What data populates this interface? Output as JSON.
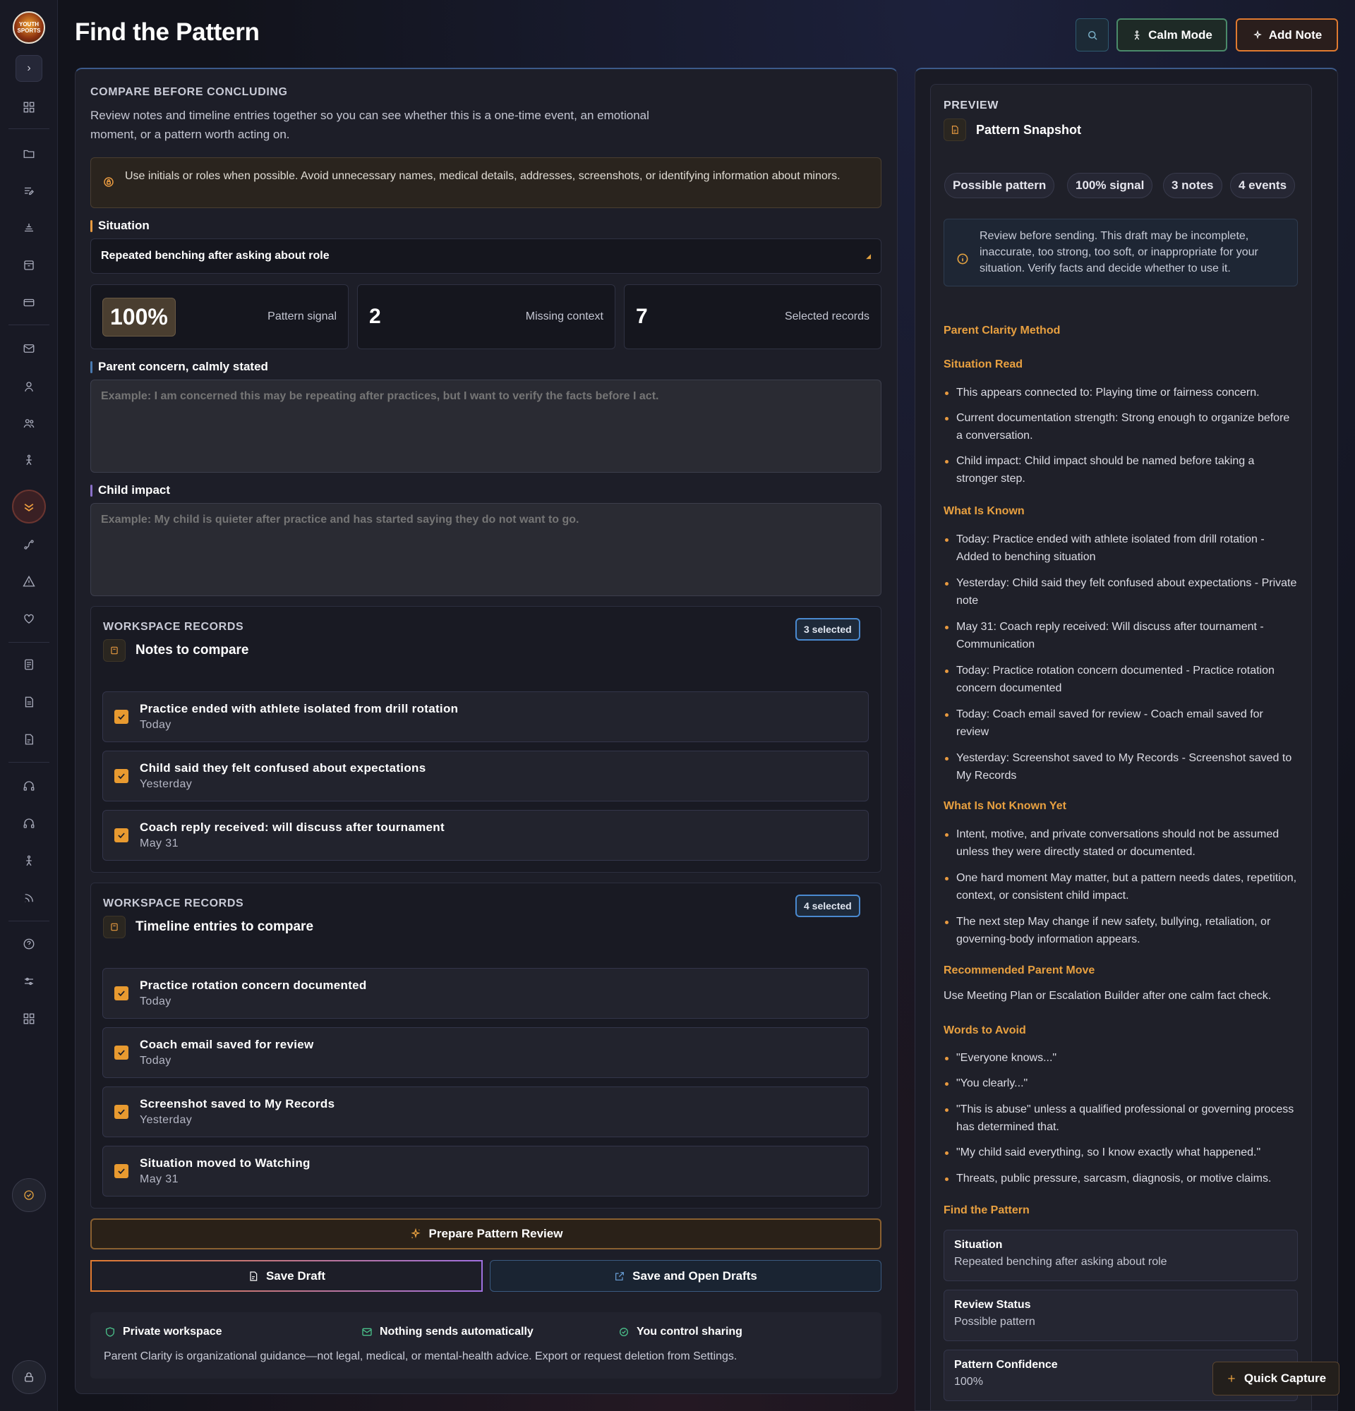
{
  "app": {
    "logo_text": "YOUTH SPORTS",
    "page_title": "Find the Pattern"
  },
  "header": {
    "calm_mode_label": "Calm Mode",
    "add_note_label": "Add Note"
  },
  "compare": {
    "eyebrow": "COMPARE BEFORE CONCLUDING",
    "description": "Review notes and timeline entries together so you can see whether this is a one-time event, an emotional moment, or a pattern worth acting on.",
    "privacy_notice": "Use initials or roles when possible. Avoid unnecessary names, medical details, addresses, screenshots, or identifying information about minors."
  },
  "situation": {
    "label": "Situation",
    "selected": "Repeated benching after asking about role"
  },
  "stats": {
    "pattern_signal_value": "100%",
    "pattern_signal_label": "Pattern signal",
    "missing_context_value": "2",
    "missing_context_label": "Missing context",
    "selected_records_value": "7",
    "selected_records_label": "Selected records"
  },
  "parent_concern": {
    "label": "Parent concern, calmly stated",
    "placeholder": "Example: I am concerned this may be repeating after practices, but I want to verify the facts before I act."
  },
  "child_impact": {
    "label": "Child impact",
    "placeholder": "Example: My child is quieter after practice and has started saying they do not want to go."
  },
  "notes_records": {
    "eyebrow": "WORKSPACE RECORDS",
    "title": "Notes to compare",
    "badge": "3 selected",
    "items": [
      {
        "name": "Practice ended with athlete isolated from drill rotation",
        "date": "Today"
      },
      {
        "name": "Child said they felt confused about expectations",
        "date": "Yesterday"
      },
      {
        "name": "Coach reply received: will discuss after tournament",
        "date": "May 31"
      }
    ]
  },
  "timeline_records": {
    "eyebrow": "WORKSPACE RECORDS",
    "title": "Timeline entries to compare",
    "badge": "4 selected",
    "items": [
      {
        "name": "Practice rotation concern documented",
        "date": "Today"
      },
      {
        "name": "Coach email saved for review",
        "date": "Today"
      },
      {
        "name": "Screenshot saved to My Records",
        "date": "Yesterday"
      },
      {
        "name": "Situation moved to Watching",
        "date": "May 31"
      }
    ]
  },
  "actions": {
    "prepare_label": "Prepare Pattern Review",
    "save_draft_label": "Save Draft",
    "save_open_label": "Save and Open Drafts"
  },
  "footer": {
    "private_label": "Private workspace",
    "nothing_sends_label": "Nothing sends automatically",
    "control_label": "You control sharing",
    "disclaimer": "Parent Clarity is organizational guidance—not legal, medical, or mental-health advice. Export or request deletion from Settings."
  },
  "preview": {
    "eyebrow": "PREVIEW",
    "title": "Pattern Snapshot",
    "chips": [
      "Possible pattern",
      "100% signal",
      "3 notes",
      "4 events"
    ],
    "warning": "Review before sending. This draft may be incomplete, inaccurate, too strong, too soft, or inappropriate for your situation. Verify facts and decide whether to use it.",
    "method_heading": "Parent Clarity Method",
    "situation_read_heading": "Situation Read",
    "situation_read": [
      "This appears connected to: Playing time or fairness concern.",
      "Current documentation strength: Strong enough to organize before a conversation.",
      "Child impact: Child impact should be named before taking a stronger step."
    ],
    "known_heading": "What Is Known",
    "known": [
      "Today: Practice ended with athlete isolated from drill rotation - Added to benching situation",
      "Yesterday: Child said they felt confused about expectations - Private note",
      "May 31: Coach reply received: Will discuss after tournament - Communication",
      "Today: Practice rotation concern documented - Practice rotation concern documented",
      "Today: Coach email saved for review - Coach email saved for review",
      "Yesterday: Screenshot saved to My Records - Screenshot saved to My Records"
    ],
    "not_known_heading": "What Is Not Known Yet",
    "not_known": [
      "Intent, motive, and private conversations should not be assumed unless they were directly stated or documented.",
      "One hard moment May matter, but a pattern needs dates, repetition, context, or consistent child impact.",
      "The next step May change if new safety, bullying, retaliation, or governing-body information appears."
    ],
    "recommended_heading": "Recommended Parent Move",
    "recommended": "Use Meeting Plan or Escalation Builder after one calm fact check.",
    "avoid_heading": "Words to Avoid",
    "avoid": [
      "\"Everyone knows...\"",
      "\"You clearly...\"",
      "\"This is abuse\" unless a qualified professional or governing process has determined that.",
      "\"My child said everything, so I know exactly what happened.\"",
      "Threats, public pressure, sarcasm, diagnosis, or motive claims."
    ],
    "find_heading": "Find the Pattern",
    "summary": [
      {
        "k": "Situation",
        "v": "Repeated benching after asking about role"
      },
      {
        "k": "Review Status",
        "v": "Possible pattern"
      },
      {
        "k": "Pattern Confidence",
        "v": "100%"
      }
    ]
  },
  "quick_capture_label": "Quick Capture"
}
